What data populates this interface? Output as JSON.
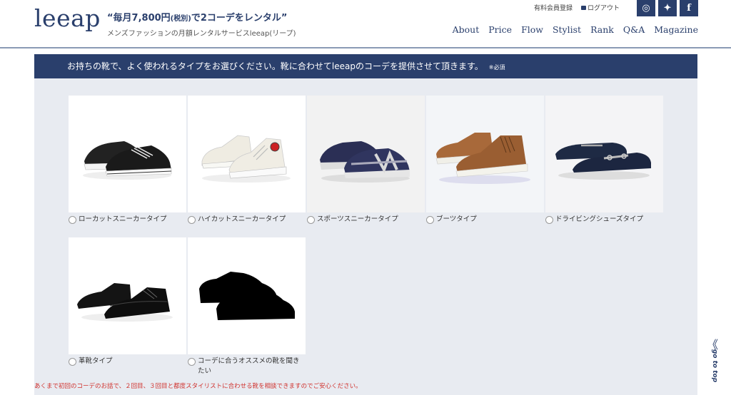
{
  "header": {
    "logo": "leeap",
    "tagline_main": "“毎月7,800円",
    "tagline_small": "(税別)",
    "tagline_rest": "で2コーデをレンタル”",
    "subtag": "メンズファッションの月額レンタルサービスleeap(リープ)",
    "register_link": "有料会員登録",
    "logout_link": "ログアウト",
    "social": [
      {
        "icon": "instagram-icon",
        "glyph": "◎"
      },
      {
        "icon": "twitter-icon",
        "glyph": "✦"
      },
      {
        "icon": "facebook-icon",
        "glyph": "f"
      }
    ],
    "nav": [
      "About",
      "Price",
      "Flow",
      "Stylist",
      "Rank",
      "Q&A",
      "Magazine"
    ]
  },
  "banner": {
    "text": "お持ちの靴で、よく使われるタイプをお選びください。靴に合わせてleeapのコーデを提供させて頂きます。",
    "required": "※必須"
  },
  "shoes": [
    {
      "label": "ローカットスニーカータイプ"
    },
    {
      "label": "ハイカットスニーカータイプ"
    },
    {
      "label": "スポーツスニーカータイプ"
    },
    {
      "label": "ブーツタイプ"
    },
    {
      "label": "ドライビングシューズタイプ"
    },
    {
      "label": "革靴タイプ"
    },
    {
      "label": "コーデに合うオススメの靴を聞きたい"
    }
  ],
  "note": "あくまで初回のコーデのお話で、２回目、３回目と都度スタイリストに合わせる靴を相談できますのでご安心ください。",
  "go_to_top": "go to top",
  "colors": {
    "navy": "#2a3f6c",
    "panel": "#e8ebf1",
    "note_red": "#d0312d"
  }
}
